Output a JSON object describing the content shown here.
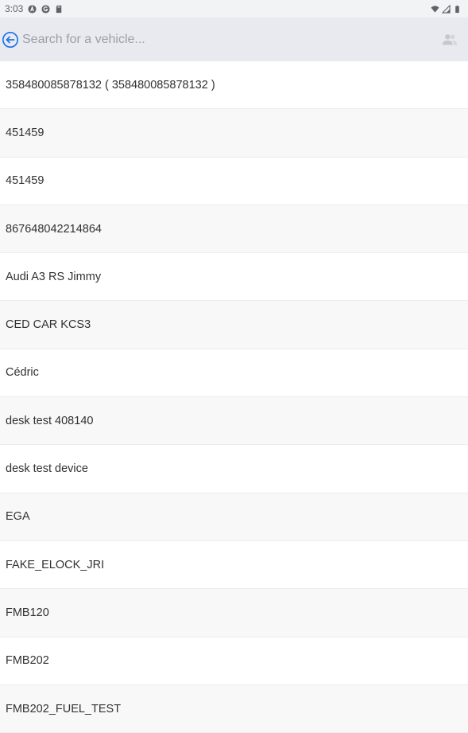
{
  "status_bar": {
    "time": "3:03",
    "left_icons": [
      "a-circle-icon",
      "g-circle-icon",
      "sd-card-icon"
    ],
    "right_icons": [
      "wifi-icon",
      "signal-icon",
      "battery-icon"
    ]
  },
  "search": {
    "placeholder": "Search for a vehicle...",
    "value": ""
  },
  "colors": {
    "accent": "#1a73e8",
    "search_bg": "#e9e9f0",
    "alt_row": "#f8f8f8"
  },
  "vehicles": [
    "358480085878132 ( 358480085878132 )",
    "451459",
    "451459",
    "867648042214864",
    "Audi A3 RS Jimmy",
    "CED CAR KCS3",
    "Cédric",
    "desk test 408140",
    "desk test device",
    "EGA",
    "FAKE_ELOCK_JRI",
    "FMB120",
    "FMB202",
    "FMB202_FUEL_TEST"
  ]
}
